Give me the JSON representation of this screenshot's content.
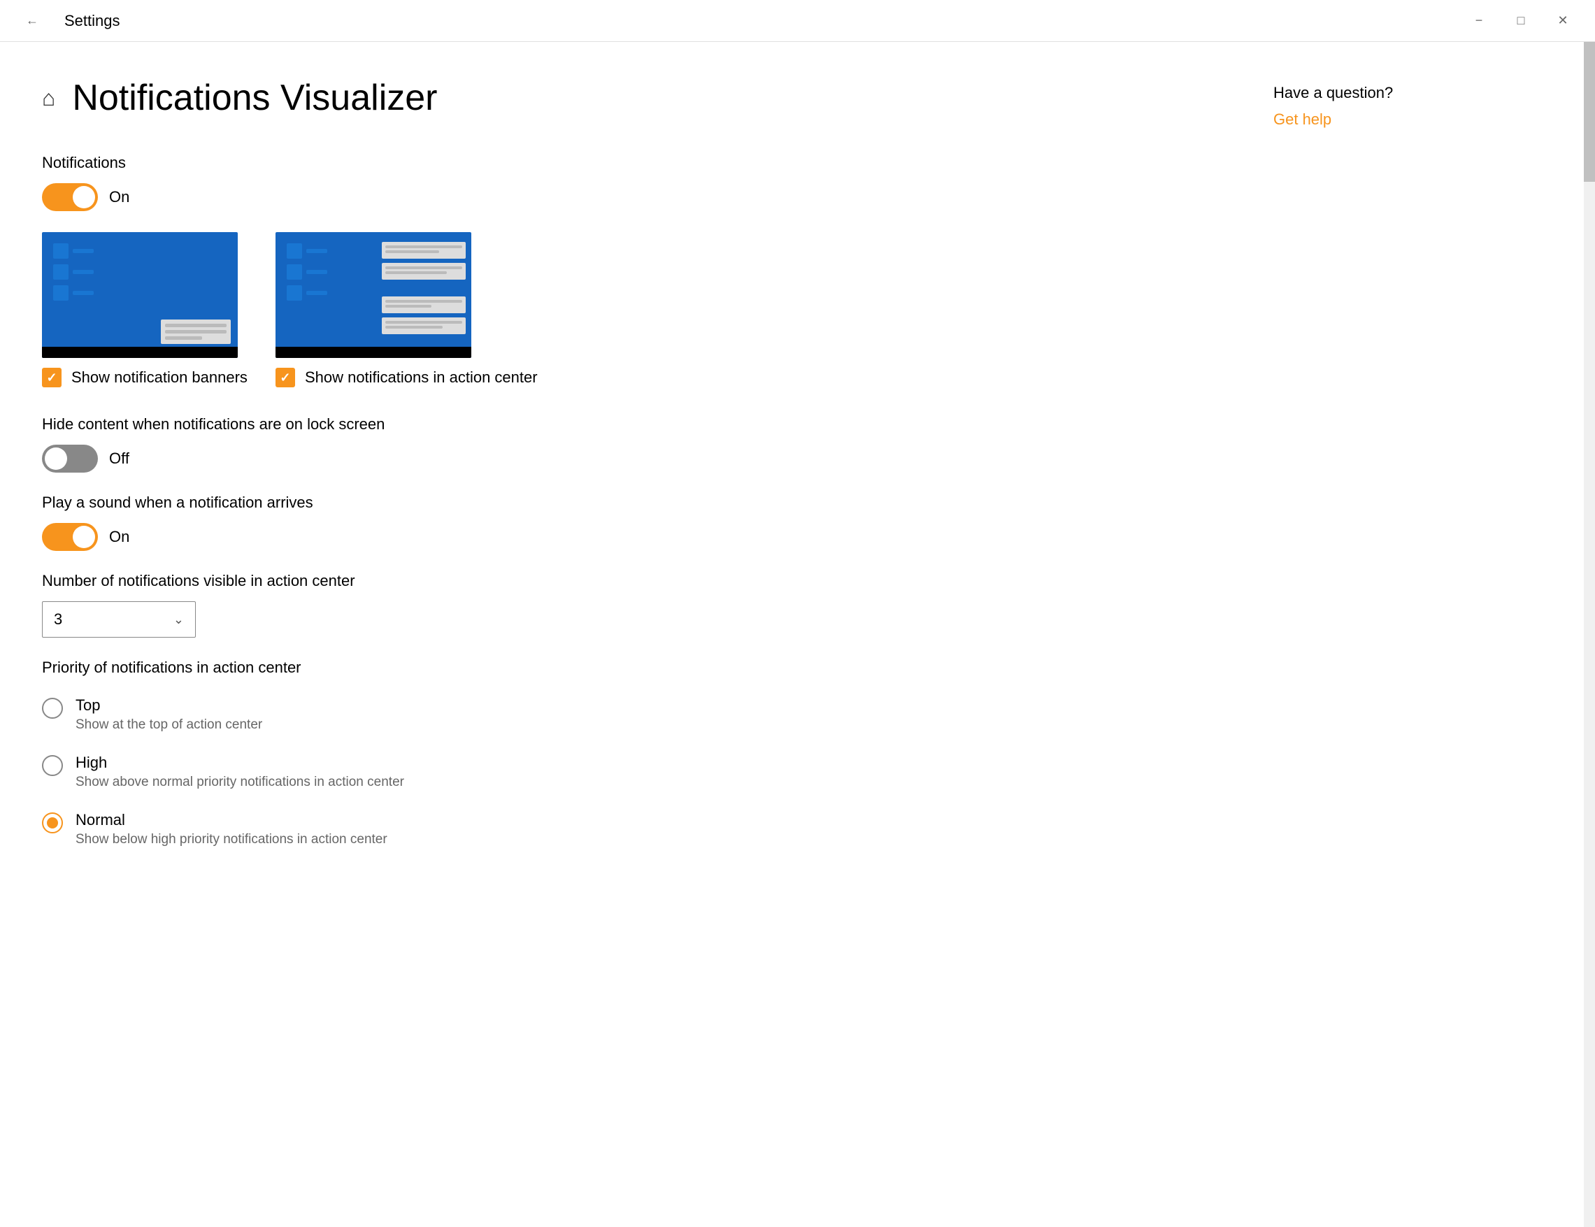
{
  "window": {
    "title": "Settings",
    "minimize_label": "−",
    "maximize_label": "□",
    "close_label": "✕"
  },
  "header": {
    "home_icon": "⌂",
    "title": "Notifications Visualizer"
  },
  "notifications": {
    "section_label": "Notifications",
    "toggle_state": "On",
    "toggle_on": true
  },
  "checkboxes": {
    "show_banners": {
      "label": "Show notification banners",
      "checked": true
    },
    "show_action_center": {
      "label": "Show notifications in action center",
      "checked": true
    }
  },
  "hide_content": {
    "label": "Hide content when notifications are on lock screen",
    "toggle_state": "Off",
    "toggle_on": false
  },
  "play_sound": {
    "label": "Play a sound when a notification arrives",
    "toggle_state": "On",
    "toggle_on": true
  },
  "num_notifications": {
    "label": "Number of notifications visible in action center",
    "value": "3"
  },
  "priority": {
    "label": "Priority of notifications in action center",
    "options": [
      {
        "label": "Top",
        "description": "Show at the top of action center",
        "selected": false
      },
      {
        "label": "High",
        "description": "Show above normal priority notifications in action center",
        "selected": false
      },
      {
        "label": "Normal",
        "description": "Show below high priority notifications in action center",
        "selected": true
      }
    ]
  },
  "help": {
    "title": "Have a question?",
    "link_label": "Get help"
  }
}
